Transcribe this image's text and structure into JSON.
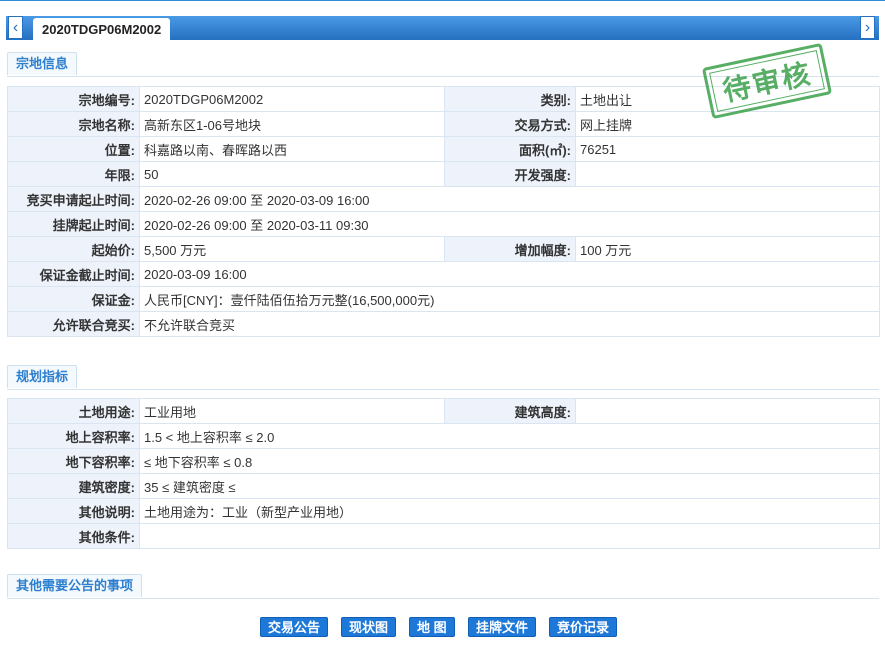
{
  "tab": {
    "title": "2020TDGP06M2002"
  },
  "nav": {
    "prev": "‹",
    "next": "›"
  },
  "stamp": {
    "text": "待审核",
    "color": "#3aa04a"
  },
  "sections": {
    "parcel": "宗地信息",
    "planning": "规划指标",
    "other": "其他需要公告的事项"
  },
  "parcel": {
    "code_label": "宗地编号:",
    "code": "2020TDGP06M2002",
    "category_label": "类别:",
    "category": "土地出让",
    "name_label": "宗地名称:",
    "name": "高新东区1-06号地块",
    "trade_label": "交易方式:",
    "trade": "网上挂牌",
    "location_label": "位置:",
    "location": "科嘉路以南、春晖路以西",
    "area_label": "面积(㎡):",
    "area": "76251",
    "term_label": "年限:",
    "term": "50",
    "intensity_label": "开发强度:",
    "intensity": "",
    "apply_label": "竞买申请起止时间:",
    "apply": "2020-02-26 09:00 至 2020-03-09 16:00",
    "listing_label": "挂牌起止时间:",
    "listing": "2020-02-26 09:00 至 2020-03-11 09:30",
    "start_price_label": "起始价:",
    "start_price": "5,500 万元",
    "increment_label": "增加幅度:",
    "increment": "100 万元",
    "deposit_deadline_label": "保证金截止时间:",
    "deposit_deadline": "2020-03-09 16:00",
    "deposit_label": "保证金:",
    "deposit": "人民币[CNY]：壹仟陆佰伍拾万元整(16,500,000元)",
    "joint_label": "允许联合竞买:",
    "joint": "不允许联合竞买"
  },
  "planning": {
    "use_label": "土地用途:",
    "use": "工业用地",
    "height_label": "建筑高度:",
    "height": "",
    "far_above_label": "地上容积率:",
    "far_above": "1.5 < 地上容积率 ≤ 2.0",
    "far_below_label": "地下容积率:",
    "far_below": "≤ 地下容积率 ≤ 0.8",
    "density_label": "建筑密度:",
    "density": "35 ≤ 建筑密度 ≤",
    "note_label": "其他说明:",
    "note": "土地用途为：工业（新型产业用地）",
    "conditions_label": "其他条件:",
    "conditions": ""
  },
  "buttons": {
    "notice": "交易公告",
    "status_map": "现状图",
    "map": "地 图",
    "listing_docs": "挂牌文件",
    "bid_records": "竞价记录"
  }
}
